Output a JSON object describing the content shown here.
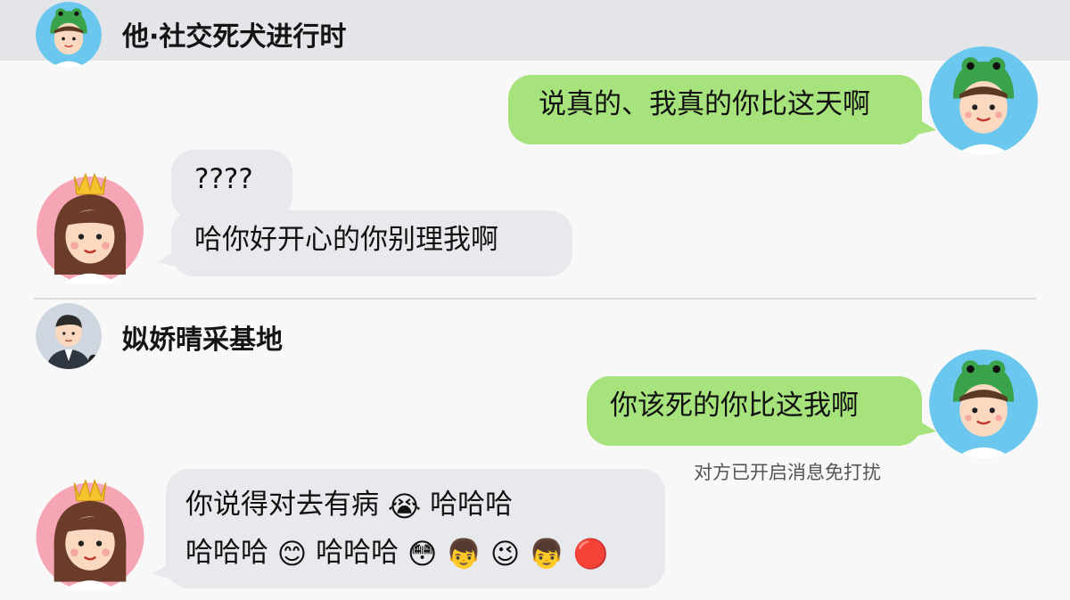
{
  "chat1": {
    "title": "他·社交死犬进行时",
    "msg_sent": "说真的、我真的你比这天啊",
    "msg_q": "????",
    "msg_reply": "哈你好开心的你别理我啊"
  },
  "chat2": {
    "title": "姒娇晴采基地",
    "msg_sent": "你该死的你比这我啊",
    "status": "对方已开启消息免打扰",
    "reply_line1_text": "你说得对去有病",
    "reply_line1_emoji": "😭",
    "reply_line1_tail": "哈哈哈",
    "reply_line2_a": "哈哈哈",
    "reply_line2_emoji1": "😊",
    "reply_line2_b": "哈哈哈",
    "reply_line2_emojis": [
      "😳",
      "👦",
      "😉",
      "👦",
      "🔴"
    ]
  },
  "colors": {
    "sent_bubble": "#a7e37c",
    "recv_bubble": "#e8e9ec",
    "header_bg": "#e3e5e9"
  },
  "icons": [
    "frog-hat-boy-avatar",
    "crown-girl-avatar",
    "suit-man-avatar"
  ]
}
